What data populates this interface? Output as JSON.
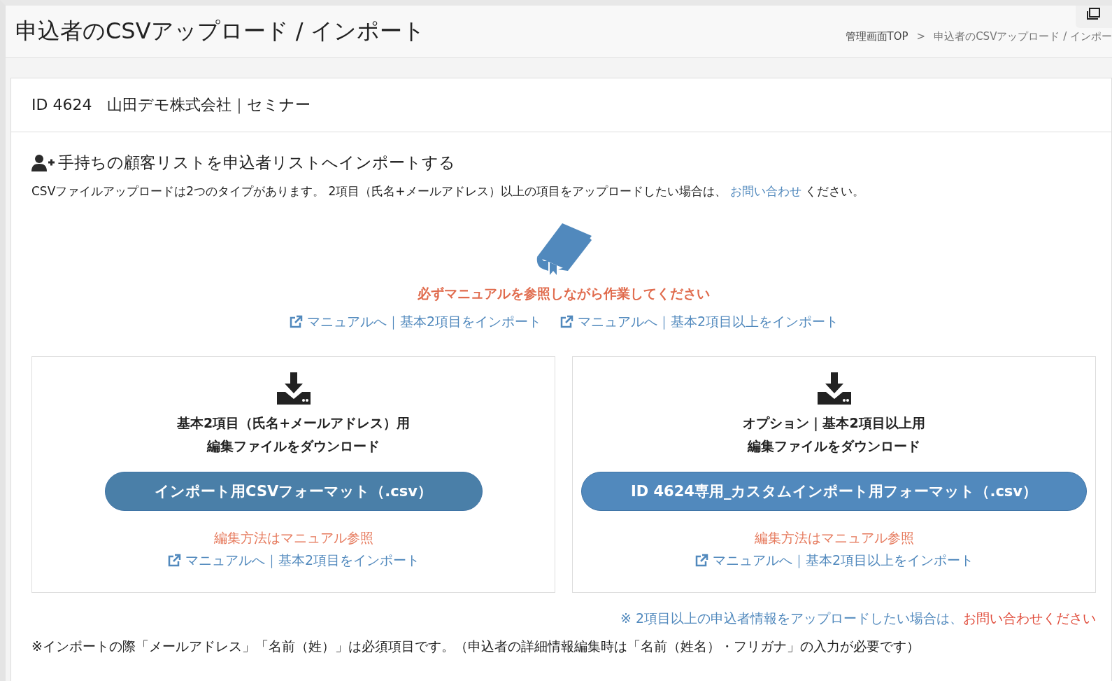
{
  "page_title": "申込者のCSVアップロード / インポート",
  "breadcrumb": {
    "items": [
      "管理画面TOP",
      "申込者のCSVアップロード / インポー"
    ],
    "separator": ">"
  },
  "card_title": "ID 4624　山田デモ株式会社｜セミナー",
  "section": {
    "heading": "手持ちの顧客リストを申込者リストへインポートする",
    "intro": "CSVファイルアップロードは2つのタイプがあります。 2項目（氏名+メールアドレス）以上の項目をアップロードしたい場合は、",
    "intro_link": "お問い合わせ",
    "intro_tail": "ください。",
    "warning": "必ずマニュアルを参照しながら作業してください",
    "manual_links": [
      "マニュアルへ｜基本2項目をインポート",
      "マニュアルへ｜基本2項目以上をインポート"
    ]
  },
  "panels": [
    {
      "title_lines": [
        "基本2項目（氏名+メールアドレス）用",
        "編集ファイルをダウンロード"
      ],
      "button": "インポート用CSVフォーマット（.csv）",
      "hovered": true,
      "note": "編集方法はマニュアル参照",
      "link": "マニュアルへ｜基本2項目をインポート"
    },
    {
      "title_lines": [
        "オプション｜基本2項目以上用",
        "編集ファイルをダウンロード"
      ],
      "button": "ID 4624専用_カスタムインポート用フォーマット（.csv）",
      "hovered": false,
      "note": "編集方法はマニュアル参照",
      "link": "マニュアルへ｜基本2項目以上をインポート"
    }
  ],
  "footnote_right": {
    "text": "※ 2項目以上の申込者情報をアップロードしたい場合は、",
    "link": "お問い合わせください"
  },
  "footnote": "※インポートの際「メールアドレス」「名前（姓）」は必須項目です。（申込者の詳細情報編集時は「名前（姓名）・フリガナ」の入力が必要です）"
}
